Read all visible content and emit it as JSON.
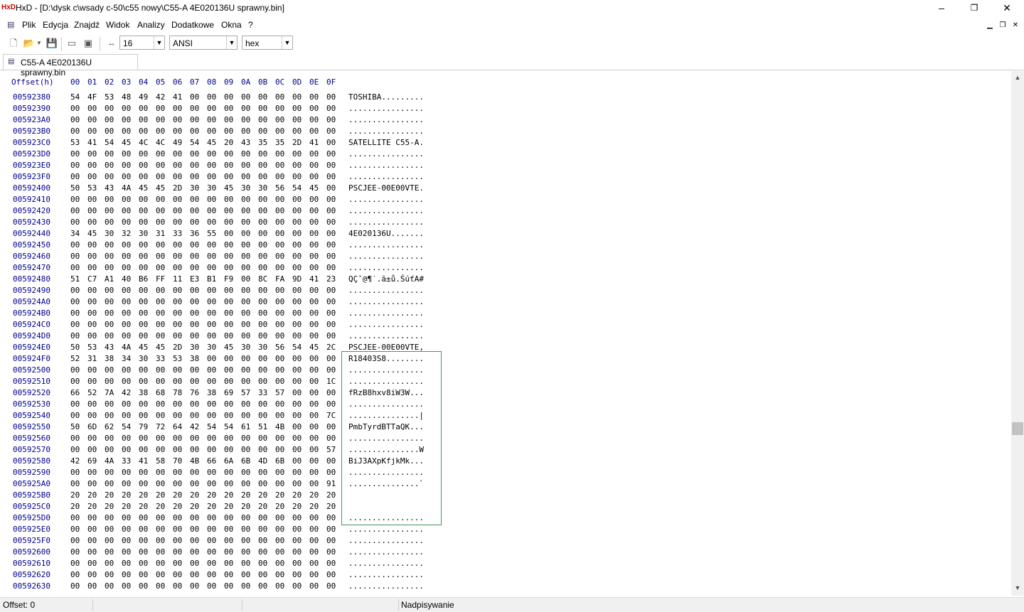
{
  "window": {
    "icon": "hxd-icon",
    "title": "HxD - [D:\\dysk c\\wsady c-50\\c55 nowy\\C55-A 4E020136U sprawny.bin]",
    "minimize": "–",
    "maximize": "❐",
    "close": "✕"
  },
  "menu": {
    "items": [
      "Plik",
      "Edycja",
      "Znajdź",
      "Widok",
      "Analizy",
      "Dodatkowe",
      "Okna",
      "?"
    ]
  },
  "toolbar": {
    "bytes_per_row": "16",
    "charset": "ANSI",
    "display_mode": "hex"
  },
  "tab": {
    "label": "C55-A 4E020136U sprawny.bin"
  },
  "editor": {
    "offset_header": "Offset(h)",
    "column_headers": [
      "00",
      "01",
      "02",
      "03",
      "04",
      "05",
      "06",
      "07",
      "08",
      "09",
      "0A",
      "0B",
      "0C",
      "0D",
      "0E",
      "0F"
    ],
    "rows": [
      {
        "offset": "00592380",
        "bytes": [
          "54",
          "4F",
          "53",
          "48",
          "49",
          "42",
          "41",
          "00",
          "00",
          "00",
          "00",
          "00",
          "00",
          "00",
          "00",
          "00"
        ],
        "ascii": "TOSHIBA........."
      },
      {
        "offset": "00592390",
        "bytes": [
          "00",
          "00",
          "00",
          "00",
          "00",
          "00",
          "00",
          "00",
          "00",
          "00",
          "00",
          "00",
          "00",
          "00",
          "00",
          "00"
        ],
        "ascii": "................"
      },
      {
        "offset": "005923A0",
        "bytes": [
          "00",
          "00",
          "00",
          "00",
          "00",
          "00",
          "00",
          "00",
          "00",
          "00",
          "00",
          "00",
          "00",
          "00",
          "00",
          "00"
        ],
        "ascii": "................"
      },
      {
        "offset": "005923B0",
        "bytes": [
          "00",
          "00",
          "00",
          "00",
          "00",
          "00",
          "00",
          "00",
          "00",
          "00",
          "00",
          "00",
          "00",
          "00",
          "00",
          "00"
        ],
        "ascii": "................"
      },
      {
        "offset": "005923C0",
        "bytes": [
          "53",
          "41",
          "54",
          "45",
          "4C",
          "4C",
          "49",
          "54",
          "45",
          "20",
          "43",
          "35",
          "35",
          "2D",
          "41",
          "00"
        ],
        "ascii": "SATELLITE C55-A."
      },
      {
        "offset": "005923D0",
        "bytes": [
          "00",
          "00",
          "00",
          "00",
          "00",
          "00",
          "00",
          "00",
          "00",
          "00",
          "00",
          "00",
          "00",
          "00",
          "00",
          "00"
        ],
        "ascii": "................"
      },
      {
        "offset": "005923E0",
        "bytes": [
          "00",
          "00",
          "00",
          "00",
          "00",
          "00",
          "00",
          "00",
          "00",
          "00",
          "00",
          "00",
          "00",
          "00",
          "00",
          "00"
        ],
        "ascii": "................"
      },
      {
        "offset": "005923F0",
        "bytes": [
          "00",
          "00",
          "00",
          "00",
          "00",
          "00",
          "00",
          "00",
          "00",
          "00",
          "00",
          "00",
          "00",
          "00",
          "00",
          "00"
        ],
        "ascii": "................"
      },
      {
        "offset": "00592400",
        "bytes": [
          "50",
          "53",
          "43",
          "4A",
          "45",
          "45",
          "2D",
          "30",
          "30",
          "45",
          "30",
          "30",
          "56",
          "54",
          "45",
          "00"
        ],
        "ascii": "PSCJEE-00E00VTE."
      },
      {
        "offset": "00592410",
        "bytes": [
          "00",
          "00",
          "00",
          "00",
          "00",
          "00",
          "00",
          "00",
          "00",
          "00",
          "00",
          "00",
          "00",
          "00",
          "00",
          "00"
        ],
        "ascii": "................"
      },
      {
        "offset": "00592420",
        "bytes": [
          "00",
          "00",
          "00",
          "00",
          "00",
          "00",
          "00",
          "00",
          "00",
          "00",
          "00",
          "00",
          "00",
          "00",
          "00",
          "00"
        ],
        "ascii": "................"
      },
      {
        "offset": "00592430",
        "bytes": [
          "00",
          "00",
          "00",
          "00",
          "00",
          "00",
          "00",
          "00",
          "00",
          "00",
          "00",
          "00",
          "00",
          "00",
          "00",
          "00"
        ],
        "ascii": "................"
      },
      {
        "offset": "00592440",
        "bytes": [
          "34",
          "45",
          "30",
          "32",
          "30",
          "31",
          "33",
          "36",
          "55",
          "00",
          "00",
          "00",
          "00",
          "00",
          "00",
          "00"
        ],
        "ascii": "4E020136U......."
      },
      {
        "offset": "00592450",
        "bytes": [
          "00",
          "00",
          "00",
          "00",
          "00",
          "00",
          "00",
          "00",
          "00",
          "00",
          "00",
          "00",
          "00",
          "00",
          "00",
          "00"
        ],
        "ascii": "................"
      },
      {
        "offset": "00592460",
        "bytes": [
          "00",
          "00",
          "00",
          "00",
          "00",
          "00",
          "00",
          "00",
          "00",
          "00",
          "00",
          "00",
          "00",
          "00",
          "00",
          "00"
        ],
        "ascii": "................"
      },
      {
        "offset": "00592470",
        "bytes": [
          "00",
          "00",
          "00",
          "00",
          "00",
          "00",
          "00",
          "00",
          "00",
          "00",
          "00",
          "00",
          "00",
          "00",
          "00",
          "00"
        ],
        "ascii": "................"
      },
      {
        "offset": "00592480",
        "bytes": [
          "51",
          "C7",
          "A1",
          "40",
          "B6",
          "FF",
          "11",
          "E3",
          "B1",
          "F9",
          "00",
          "8C",
          "FA",
          "9D",
          "41",
          "23"
        ],
        "ascii": "QÇˇ@¶˙.ă±ů.ŚúťA#"
      },
      {
        "offset": "00592490",
        "bytes": [
          "00",
          "00",
          "00",
          "00",
          "00",
          "00",
          "00",
          "00",
          "00",
          "00",
          "00",
          "00",
          "00",
          "00",
          "00",
          "00"
        ],
        "ascii": "................"
      },
      {
        "offset": "005924A0",
        "bytes": [
          "00",
          "00",
          "00",
          "00",
          "00",
          "00",
          "00",
          "00",
          "00",
          "00",
          "00",
          "00",
          "00",
          "00",
          "00",
          "00"
        ],
        "ascii": "................"
      },
      {
        "offset": "005924B0",
        "bytes": [
          "00",
          "00",
          "00",
          "00",
          "00",
          "00",
          "00",
          "00",
          "00",
          "00",
          "00",
          "00",
          "00",
          "00",
          "00",
          "00"
        ],
        "ascii": "................"
      },
      {
        "offset": "005924C0",
        "bytes": [
          "00",
          "00",
          "00",
          "00",
          "00",
          "00",
          "00",
          "00",
          "00",
          "00",
          "00",
          "00",
          "00",
          "00",
          "00",
          "00"
        ],
        "ascii": "................"
      },
      {
        "offset": "005924D0",
        "bytes": [
          "00",
          "00",
          "00",
          "00",
          "00",
          "00",
          "00",
          "00",
          "00",
          "00",
          "00",
          "00",
          "00",
          "00",
          "00",
          "00"
        ],
        "ascii": "................"
      },
      {
        "offset": "005924E0",
        "bytes": [
          "50",
          "53",
          "43",
          "4A",
          "45",
          "45",
          "2D",
          "30",
          "30",
          "45",
          "30",
          "30",
          "56",
          "54",
          "45",
          "2C"
        ],
        "ascii": "PSCJEE-00E00VTE,"
      },
      {
        "offset": "005924F0",
        "bytes": [
          "52",
          "31",
          "38",
          "34",
          "30",
          "33",
          "53",
          "38",
          "00",
          "00",
          "00",
          "00",
          "00",
          "00",
          "00",
          "00"
        ],
        "ascii": "R18403S8........"
      },
      {
        "offset": "00592500",
        "bytes": [
          "00",
          "00",
          "00",
          "00",
          "00",
          "00",
          "00",
          "00",
          "00",
          "00",
          "00",
          "00",
          "00",
          "00",
          "00",
          "00"
        ],
        "ascii": "................"
      },
      {
        "offset": "00592510",
        "bytes": [
          "00",
          "00",
          "00",
          "00",
          "00",
          "00",
          "00",
          "00",
          "00",
          "00",
          "00",
          "00",
          "00",
          "00",
          "00",
          "1C"
        ],
        "ascii": "................"
      },
      {
        "offset": "00592520",
        "bytes": [
          "66",
          "52",
          "7A",
          "42",
          "38",
          "68",
          "78",
          "76",
          "38",
          "69",
          "57",
          "33",
          "57",
          "00",
          "00",
          "00"
        ],
        "ascii": "fRzB8hxv8iW3W..."
      },
      {
        "offset": "00592530",
        "bytes": [
          "00",
          "00",
          "00",
          "00",
          "00",
          "00",
          "00",
          "00",
          "00",
          "00",
          "00",
          "00",
          "00",
          "00",
          "00",
          "00"
        ],
        "ascii": "................"
      },
      {
        "offset": "00592540",
        "bytes": [
          "00",
          "00",
          "00",
          "00",
          "00",
          "00",
          "00",
          "00",
          "00",
          "00",
          "00",
          "00",
          "00",
          "00",
          "00",
          "7C"
        ],
        "ascii": "...............|"
      },
      {
        "offset": "00592550",
        "bytes": [
          "50",
          "6D",
          "62",
          "54",
          "79",
          "72",
          "64",
          "42",
          "54",
          "54",
          "61",
          "51",
          "4B",
          "00",
          "00",
          "00"
        ],
        "ascii": "PmbTyrdBTTaQK..."
      },
      {
        "offset": "00592560",
        "bytes": [
          "00",
          "00",
          "00",
          "00",
          "00",
          "00",
          "00",
          "00",
          "00",
          "00",
          "00",
          "00",
          "00",
          "00",
          "00",
          "00"
        ],
        "ascii": "................"
      },
      {
        "offset": "00592570",
        "bytes": [
          "00",
          "00",
          "00",
          "00",
          "00",
          "00",
          "00",
          "00",
          "00",
          "00",
          "00",
          "00",
          "00",
          "00",
          "00",
          "57"
        ],
        "ascii": "...............W"
      },
      {
        "offset": "00592580",
        "bytes": [
          "42",
          "69",
          "4A",
          "33",
          "41",
          "58",
          "70",
          "4B",
          "66",
          "6A",
          "6B",
          "4D",
          "6B",
          "00",
          "00",
          "00"
        ],
        "ascii": "BiJ3AXpKfjkMk..."
      },
      {
        "offset": "00592590",
        "bytes": [
          "00",
          "00",
          "00",
          "00",
          "00",
          "00",
          "00",
          "00",
          "00",
          "00",
          "00",
          "00",
          "00",
          "00",
          "00",
          "00"
        ],
        "ascii": "................"
      },
      {
        "offset": "005925A0",
        "bytes": [
          "00",
          "00",
          "00",
          "00",
          "00",
          "00",
          "00",
          "00",
          "00",
          "00",
          "00",
          "00",
          "00",
          "00",
          "00",
          "91"
        ],
        "ascii": "...............`"
      },
      {
        "offset": "005925B0",
        "bytes": [
          "20",
          "20",
          "20",
          "20",
          "20",
          "20",
          "20",
          "20",
          "20",
          "20",
          "20",
          "20",
          "20",
          "20",
          "20",
          "20"
        ],
        "ascii": "                "
      },
      {
        "offset": "005925C0",
        "bytes": [
          "20",
          "20",
          "20",
          "20",
          "20",
          "20",
          "20",
          "20",
          "20",
          "20",
          "20",
          "20",
          "20",
          "20",
          "20",
          "20"
        ],
        "ascii": "                "
      },
      {
        "offset": "005925D0",
        "bytes": [
          "00",
          "00",
          "00",
          "00",
          "00",
          "00",
          "00",
          "00",
          "00",
          "00",
          "00",
          "00",
          "00",
          "00",
          "00",
          "00"
        ],
        "ascii": "................"
      },
      {
        "offset": "005925E0",
        "bytes": [
          "00",
          "00",
          "00",
          "00",
          "00",
          "00",
          "00",
          "00",
          "00",
          "00",
          "00",
          "00",
          "00",
          "00",
          "00",
          "00"
        ],
        "ascii": "................"
      },
      {
        "offset": "005925F0",
        "bytes": [
          "00",
          "00",
          "00",
          "00",
          "00",
          "00",
          "00",
          "00",
          "00",
          "00",
          "00",
          "00",
          "00",
          "00",
          "00",
          "00"
        ],
        "ascii": "................"
      },
      {
        "offset": "00592600",
        "bytes": [
          "00",
          "00",
          "00",
          "00",
          "00",
          "00",
          "00",
          "00",
          "00",
          "00",
          "00",
          "00",
          "00",
          "00",
          "00",
          "00"
        ],
        "ascii": "................"
      },
      {
        "offset": "00592610",
        "bytes": [
          "00",
          "00",
          "00",
          "00",
          "00",
          "00",
          "00",
          "00",
          "00",
          "00",
          "00",
          "00",
          "00",
          "00",
          "00",
          "00"
        ],
        "ascii": "................"
      },
      {
        "offset": "00592620",
        "bytes": [
          "00",
          "00",
          "00",
          "00",
          "00",
          "00",
          "00",
          "00",
          "00",
          "00",
          "00",
          "00",
          "00",
          "00",
          "00",
          "00"
        ],
        "ascii": "................"
      },
      {
        "offset": "00592630",
        "bytes": [
          "00",
          "00",
          "00",
          "00",
          "00",
          "00",
          "00",
          "00",
          "00",
          "00",
          "00",
          "00",
          "00",
          "00",
          "00",
          "00"
        ],
        "ascii": "................"
      }
    ]
  },
  "status": {
    "offset": "Offset: 0",
    "mode": "Nadpisywanie"
  },
  "colors": {
    "offset_color": "#00008b",
    "selection_border": "#3a9a5a"
  }
}
